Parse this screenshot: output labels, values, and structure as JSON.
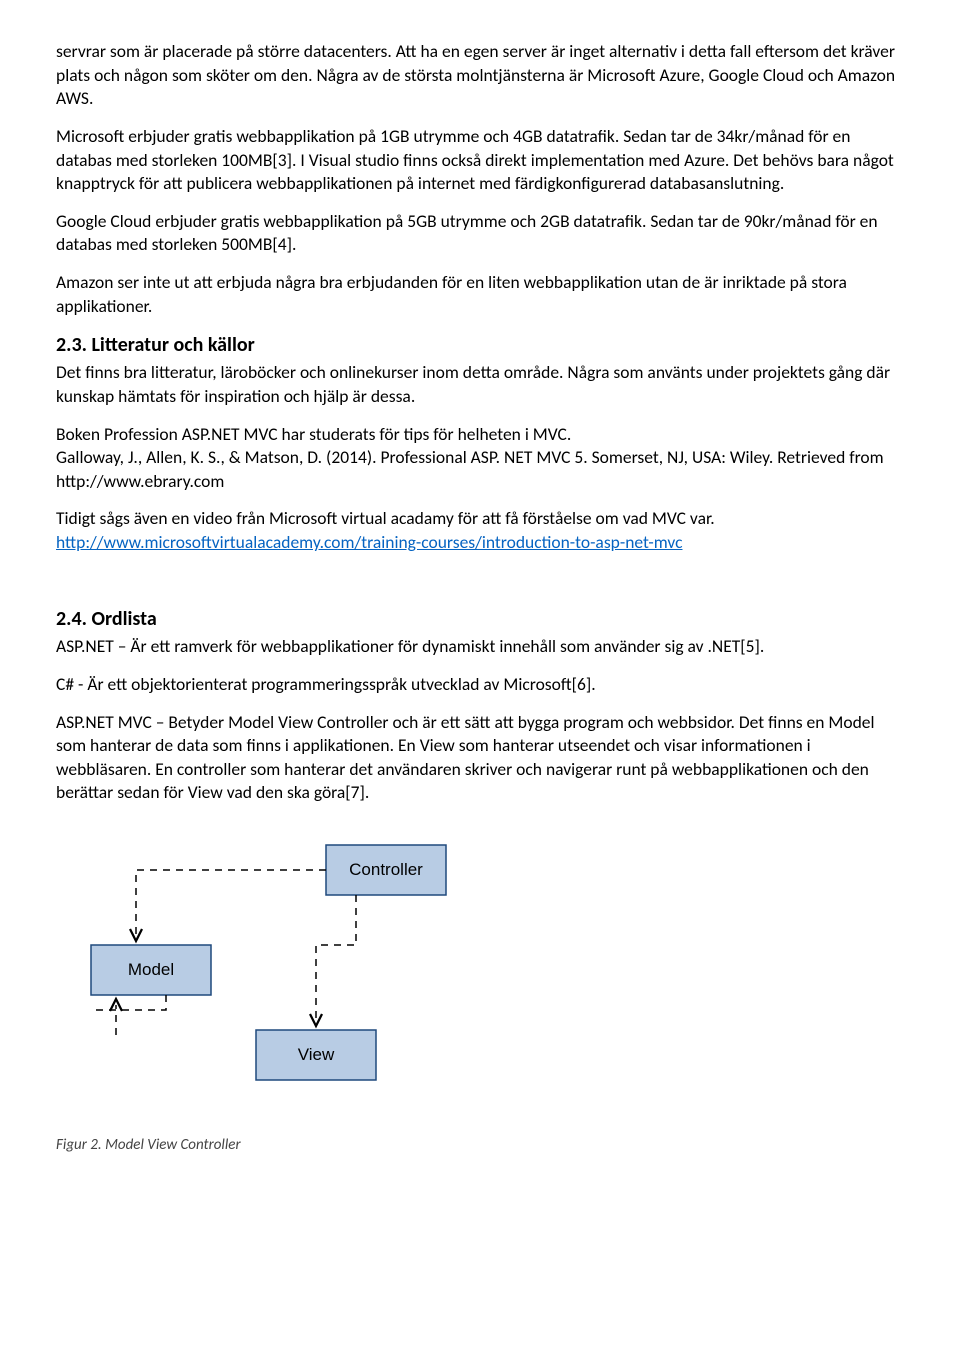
{
  "para1": "servrar som är placerade på större datacenters. Att ha en egen server är inget alternativ i detta fall eftersom det kräver plats och någon som sköter om den. Några av de största molntjänsterna är Microsoft Azure, Google Cloud och Amazon AWS.",
  "para2": "Microsoft erbjuder gratis webbapplikation på 1GB utrymme och 4GB datatrafik. Sedan tar de 34kr/månad för en databas med storleken 100MB[3]. I Visual studio finns också direkt implementation med Azure. Det behövs bara något knapptryck för att publicera webbapplikationen på internet med färdigkonfigurerad databasanslutning.",
  "para3": "Google Cloud erbjuder gratis webbapplikation på 5GB utrymme och 2GB datatrafik. Sedan tar de 90kr/månad för en databas med storleken 500MB[4].",
  "para4": "Amazon ser inte ut att erbjuda några bra erbjudanden för en liten webbapplikation utan de är inriktade på stora applikationer.",
  "section23": {
    "title": "2.3. Litteratur och källor",
    "intro": "Det finns bra litteratur, läroböcker och onlinekurser inom detta område. Några som använts under projektets gång där kunskap hämtats för inspiration och hjälp är dessa.",
    "book_line1": "Boken Profession ASP.NET MVC har studerats för tips för helheten i MVC.",
    "book_line2": "Galloway, J., Allen, K. S., & Matson, D. (2014). Professional ASP. NET MVC 5. Somerset, NJ, USA: Wiley. Retrieved from http://www.ebrary.com",
    "video_line": "Tidigt sågs även en video från Microsoft virtual acadamy för att få förståelse om vad MVC var.",
    "video_link": "http://www.microsoftvirtualacademy.com/training-courses/introduction-to-asp-net-mvc"
  },
  "section24": {
    "title": "2.4. Ordlista",
    "aspnet": "ASP.NET – Är ett ramverk för webbapplikationer för dynamiskt innehåll som använder sig av .NET[5].",
    "csharp": "C# - Är ett objektorienterat programmeringsspråk utvecklad av Microsoft[6].",
    "mvc": "ASP.NET MVC – Betyder Model View Controller och är ett sätt att bygga program och webbsidor. Det finns en Model som hanterar de data som finns i applikationen. En View som hanterar utseendet och visar informationen i webbläsaren. En controller som hanterar det användaren skriver och navigerar runt på webbapplikationen och den berättar sedan för View vad den ska göra[7]."
  },
  "diagram": {
    "controller": "Controller",
    "model": "Model",
    "view": "View",
    "caption": "Figur 2. Model View Controller"
  }
}
